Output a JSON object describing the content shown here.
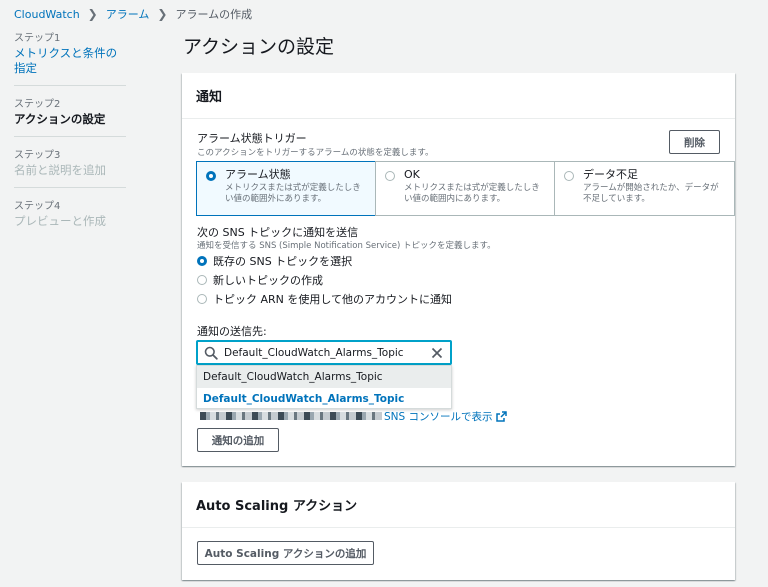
{
  "breadcrumb": {
    "root": "CloudWatch",
    "alarms": "アラーム",
    "current": "アラームの作成"
  },
  "steps": [
    {
      "num": "ステップ1",
      "title": "メトリクスと条件の指定"
    },
    {
      "num": "ステップ2",
      "title": "アクションの設定"
    },
    {
      "num": "ステップ3",
      "title": "名前と説明を追加"
    },
    {
      "num": "ステップ4",
      "title": "プレビューと作成"
    }
  ],
  "page_title": "アクションの設定",
  "notification": {
    "header": "通知",
    "trigger_label": "アラーム状態トリガー",
    "trigger_desc": "このアクションをトリガーするアラームの状態を定義します。",
    "remove_label": "削除",
    "tiles": [
      {
        "title": "アラーム状態",
        "desc": "メトリクスまたは式が定義したしきい値の範囲外にあります。"
      },
      {
        "title": "OK",
        "desc": "メトリクスまたは式が定義したしきい値の範囲内にあります。"
      },
      {
        "title": "データ不足",
        "desc": "アラームが開始されたか、データが不足しています。"
      }
    ],
    "sns_label": "次の SNS トピックに通知を送信",
    "sns_desc": "通知を受信する SNS (Simple Notification Service) トピックを定義します。",
    "sns_options": [
      "既存の SNS トピックを選択",
      "新しいトピックの作成",
      "トピック ARN を使用して他のアカウントに通知"
    ],
    "send_to_label": "通知の送信先:",
    "search_value": "Default_CloudWatch_Alarms_Topic",
    "dropdown_options": [
      "Default_CloudWatch_Alarms_Topic",
      "Default_CloudWatch_Alarms_Topic"
    ],
    "console_link": "SNS コンソールで表示",
    "add_button": "通知の追加"
  },
  "autoscaling": {
    "header": "Auto Scaling アクション",
    "add_button": "Auto Scaling アクションの追加"
  },
  "colors": {
    "accent": "#0073bb",
    "focus": "#00a1c9"
  }
}
